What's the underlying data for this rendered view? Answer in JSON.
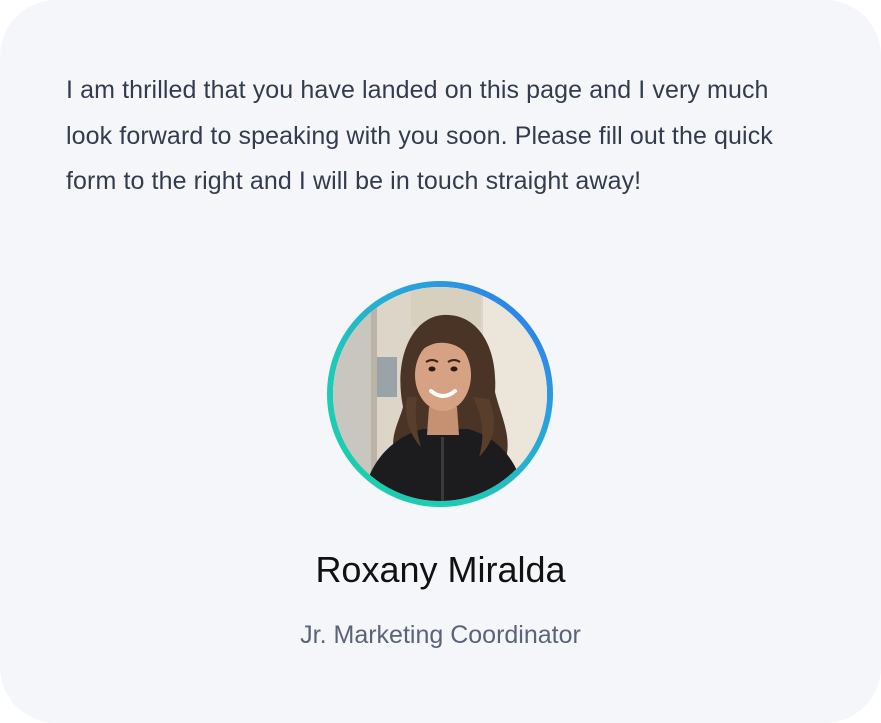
{
  "profile": {
    "intro_text": "I am thrilled that you have landed on this page and I very much look forward to speaking with you soon. Please fill out the quick form to the right and I will be in touch straight away!",
    "name": "Roxany Miralda",
    "role": "Jr. Marketing Coordinator",
    "avatar_icon": "person-photo-icon"
  },
  "colors": {
    "card_background": "#f4f6f9",
    "intro_text": "#333c4e",
    "name_text": "#111111",
    "role_text": "#5a6478",
    "ring_gradient_start": "#19d3a8",
    "ring_gradient_end": "#2f6ef0"
  }
}
